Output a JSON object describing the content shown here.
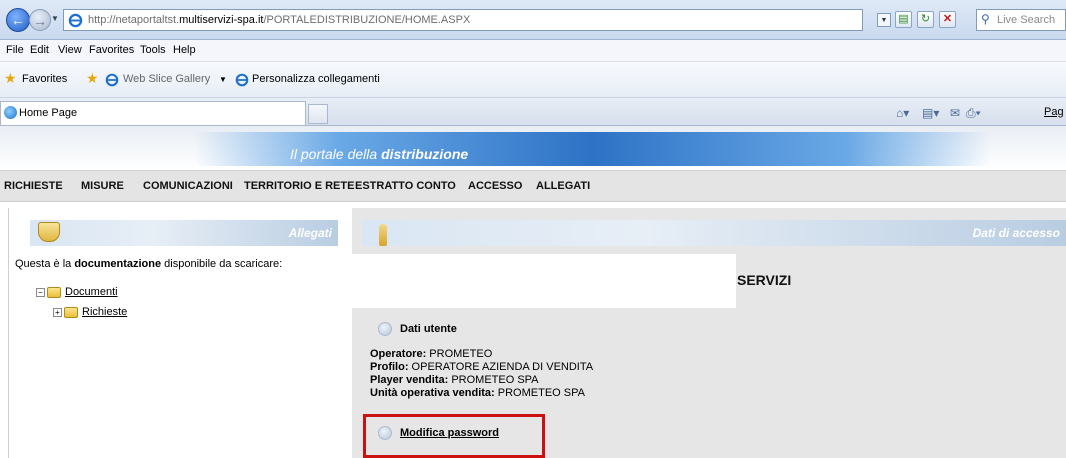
{
  "browser": {
    "url_prefix": "http://netaportaltst.",
    "url_domain": "multiservizi-spa.it",
    "url_path": "/PORTALEDISTRIBUZIONE/HOME.ASPX",
    "search_placeholder": "Live Search",
    "menu": [
      "File",
      "Edit",
      "View",
      "Favorites",
      "Tools",
      "Help"
    ],
    "favorites_label": "Favorites",
    "web_slice_label": "Web Slice Gallery",
    "personalize_label": "Personalizza collegamenti",
    "tab_title": "Home Page",
    "page_menu_label": "Pag"
  },
  "banner": {
    "title_prefix": "Il portale della ",
    "title_bold": "distribuzione"
  },
  "nav": [
    "RICHIESTE",
    "MISURE",
    "COMUNICAZIONI",
    "TERRITORIO E RETE",
    "ESTRATTO CONTO",
    "ACCESSO",
    "ALLEGATI"
  ],
  "left": {
    "title": "Allegati",
    "intro_prefix": "Questa è la ",
    "intro_bold": "documentazione",
    "intro_suffix": " disponibile da scaricare:",
    "tree": [
      {
        "label": "Documenti",
        "sign": "−"
      },
      {
        "label": "Richieste",
        "sign": "+"
      }
    ]
  },
  "right": {
    "title": "Dati di accesso",
    "services_title": "SERVIZI",
    "user_section": "Dati utente",
    "fields": [
      {
        "label": "Operatore:",
        "value": " PROMETEO"
      },
      {
        "label": "Profilo:",
        "value": " OPERATORE AZIENDA DI VENDITA"
      },
      {
        "label": "Player vendita:",
        "value": " PROMETEO SPA"
      },
      {
        "label": "Unità operativa vendita:",
        "value": " PROMETEO SPA"
      }
    ],
    "change_password": "Modifica password"
  }
}
